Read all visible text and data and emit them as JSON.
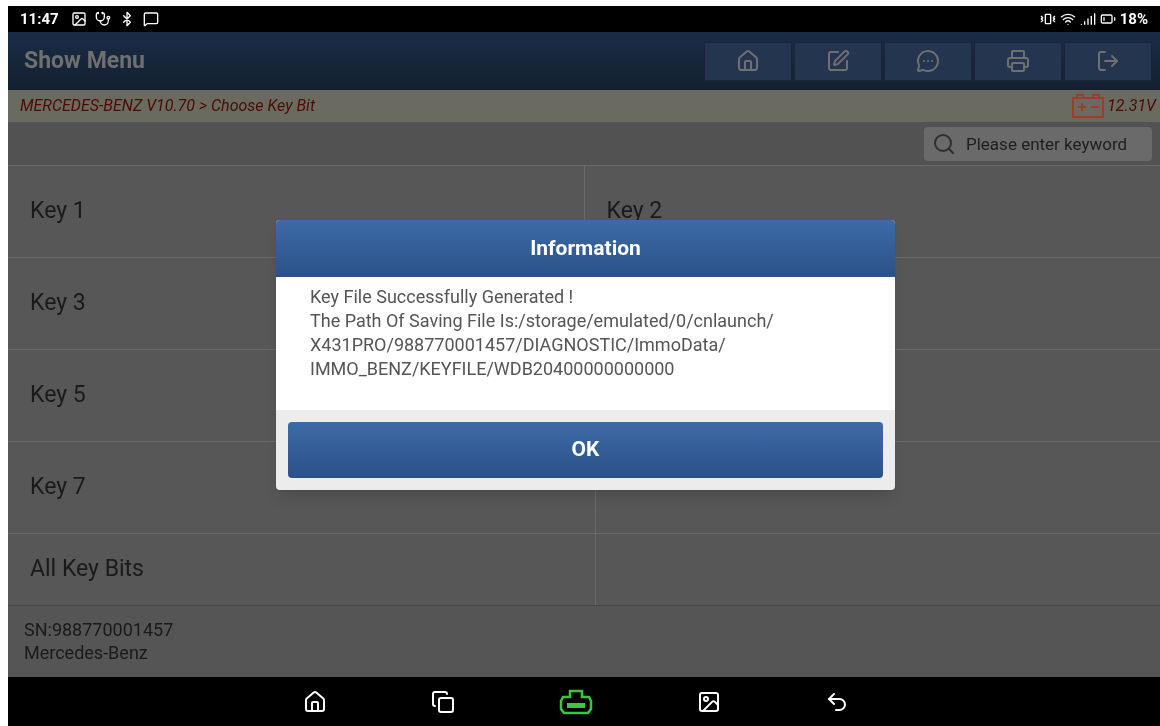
{
  "status_bar": {
    "time": "11:47",
    "battery": "18%"
  },
  "header": {
    "title": "Show Menu",
    "toolbar": [
      {
        "kind": "home"
      },
      {
        "kind": "edit"
      },
      {
        "kind": "chat"
      },
      {
        "kind": "print"
      },
      {
        "kind": "exit"
      }
    ]
  },
  "breadcrumb": {
    "path": "MERCEDES-BENZ V10.70 > Choose Key Bit",
    "voltage": "12.31V"
  },
  "search": {
    "placeholder": "Please enter keyword"
  },
  "menu_rows": [
    {
      "left": {
        "label": "Key 1"
      },
      "right": {
        "label": "Key 2"
      }
    },
    {
      "left": {
        "label": "Key 3"
      }
    },
    {
      "left": {
        "label": "Key 5"
      }
    },
    {
      "left": {
        "label": "Key 7"
      }
    },
    {
      "left": {
        "label": "All Key Bits"
      }
    }
  ],
  "footer": {
    "serial": "SN:988770001457",
    "make": "Mercedes-Benz"
  },
  "dialog": {
    "title": "Information",
    "message_lines": [
      "Key File Successfully Generated !",
      "The Path Of Saving File Is:/storage/emulated/0/cnlaunch/",
      "X431PRO/988770001457/DIAGNOSTIC/ImmoData/",
      "IMMO_BENZ/KEYFILE/WDB20400000000000"
    ],
    "button": "OK"
  },
  "nav_bar": [
    {
      "kind": "home"
    },
    {
      "kind": "recents"
    },
    {
      "kind": "vci"
    },
    {
      "kind": "gallery"
    },
    {
      "kind": "back"
    }
  ]
}
